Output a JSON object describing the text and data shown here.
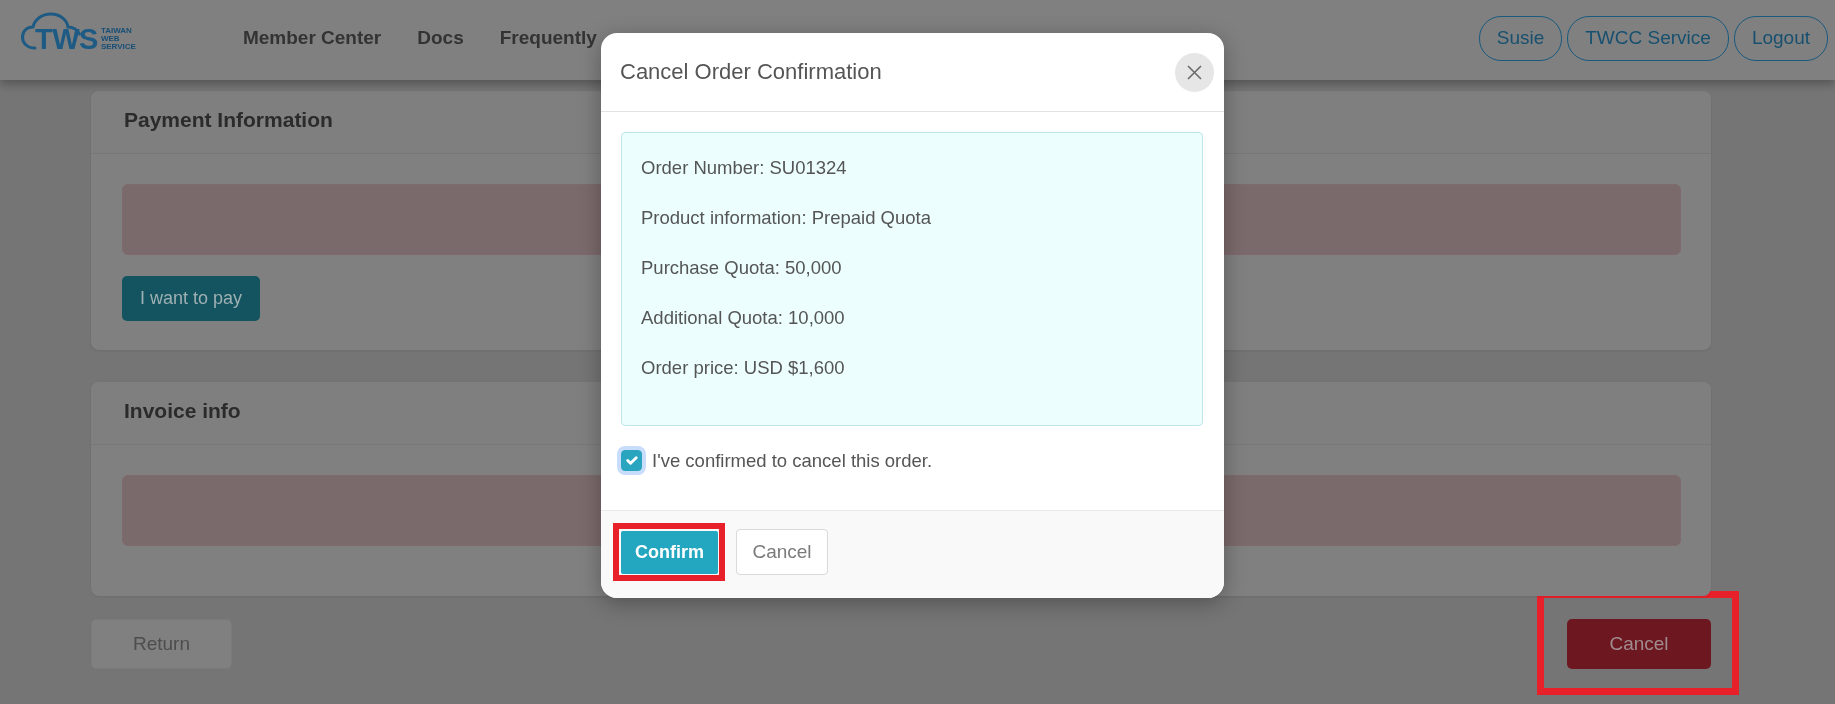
{
  "navbar": {
    "logo": {
      "mark": "TWS",
      "tagline": [
        "TAIWAN",
        "WEB",
        "SERVICE"
      ]
    },
    "links": [
      "Member Center",
      "Docs",
      "Frequently"
    ],
    "account_buttons": [
      "Susie",
      "TWCC Service",
      "Logout"
    ]
  },
  "sections": [
    {
      "title": "Payment Information",
      "button": "I want to pay"
    },
    {
      "title": "Invoice info"
    }
  ],
  "actions": [
    {
      "label": "Return",
      "kind": "light",
      "highlighted": false
    },
    {
      "label": "Cancel",
      "kind": "danger",
      "highlighted": true
    }
  ],
  "modal": {
    "title": "Cancel Order Confirmation",
    "details": [
      "Order Number: SU01324",
      "Product information: Prepaid Quota",
      "Purchase Quota: 50,000",
      "Additional Quota: 10,000",
      "Order price: USD $1,600"
    ],
    "checkbox": {
      "label": "I've confirmed to cancel this order.",
      "checked": true
    },
    "buttons": [
      {
        "label": "Confirm",
        "kind": "primary",
        "highlighted": true
      },
      {
        "label": "Cancel",
        "kind": "secondary",
        "highlighted": false
      }
    ]
  }
}
